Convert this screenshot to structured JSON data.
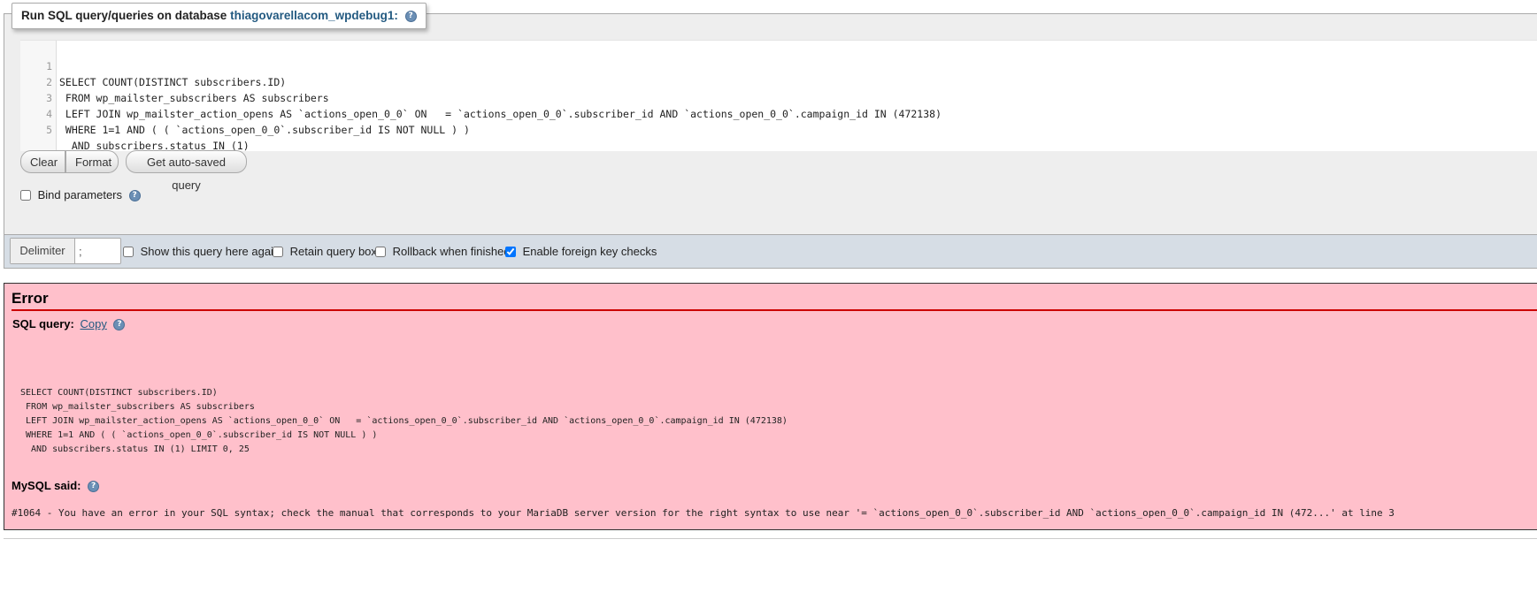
{
  "query_panel": {
    "legend_prefix": "Run SQL query/queries on database",
    "database": "thiagovarellacom_wpdebug1:",
    "help_icon": "?"
  },
  "editor": {
    "lines": [
      {
        "num": "1",
        "text": "SELECT COUNT(DISTINCT subscribers.ID)"
      },
      {
        "num": "2",
        "text": " FROM wp_mailster_subscribers AS subscribers"
      },
      {
        "num": "3",
        "text": " LEFT JOIN wp_mailster_action_opens AS `actions_open_0_0` ON   = `actions_open_0_0`.subscriber_id AND `actions_open_0_0`.campaign_id IN (472138)"
      },
      {
        "num": "4",
        "text": " WHERE 1=1 AND ( ( `actions_open_0_0`.subscriber_id IS NOT NULL ) )"
      },
      {
        "num": "5",
        "text": "  AND subscribers.status IN (1)"
      }
    ]
  },
  "buttons": {
    "clear": "Clear",
    "format": "Format",
    "auto_saved": "Get auto-saved query"
  },
  "bind_params": {
    "label": "Bind parameters",
    "checked": false
  },
  "options": {
    "delimiter_label": "Delimiter",
    "delimiter_value": ";",
    "show_query": {
      "label": "Show this query here again",
      "checked": false
    },
    "retain_box": {
      "label": "Retain query box",
      "checked": false
    },
    "rollback": {
      "label": "Rollback when finished",
      "checked": false
    },
    "fk_checks": {
      "label": "Enable foreign key checks",
      "checked": true
    }
  },
  "error": {
    "title": "Error",
    "sql_query_label": "SQL query:",
    "copy_label": "Copy",
    "query_lines": [
      "SELECT COUNT(DISTINCT subscribers.ID)",
      " FROM wp_mailster_subscribers AS subscribers",
      " LEFT JOIN wp_mailster_action_opens AS `actions_open_0_0` ON   = `actions_open_0_0`.subscriber_id AND `actions_open_0_0`.campaign_id IN (472138)",
      " WHERE 1=1 AND ( ( `actions_open_0_0`.subscriber_id IS NOT NULL ) )",
      "  AND subscribers.status IN (1) LIMIT 0, 25"
    ],
    "mysql_said_label": "MySQL said:",
    "message": "#1064 - You have an error in your SQL syntax; check the manual that corresponds to your MariaDB server version for the right syntax to use near '= `actions_open_0_0`.subscriber_id AND `actions_open_0_0`.campaign_id IN (472...' at line 3"
  }
}
